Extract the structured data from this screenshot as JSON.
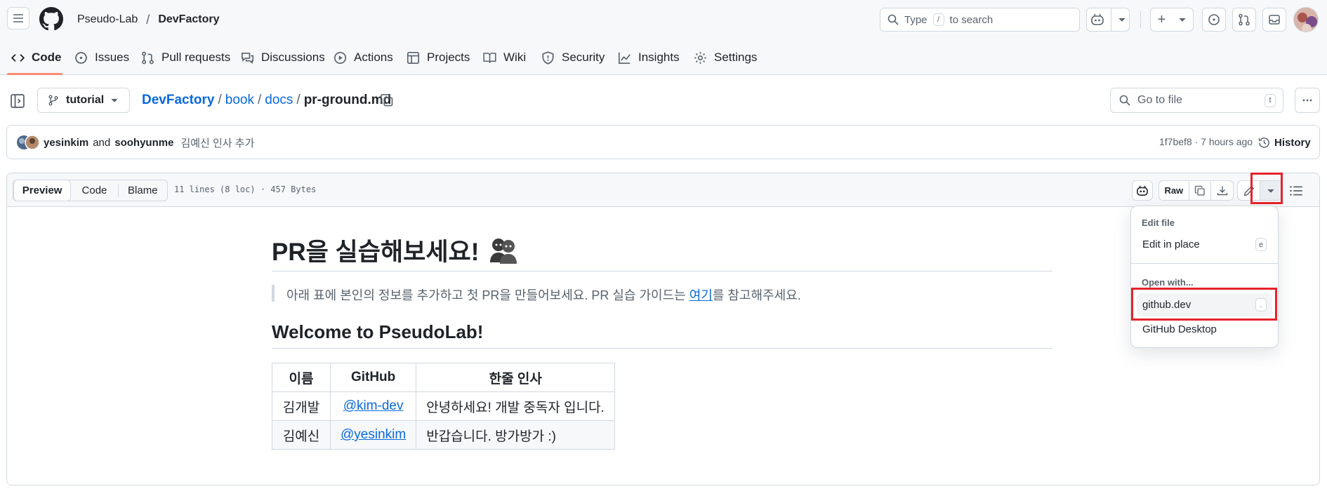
{
  "header": {
    "owner": "Pseudo-Lab",
    "separator": "/",
    "repo": "DevFactory",
    "search_placeholder_pre": "Type",
    "search_key": "/",
    "search_placeholder_post": "to search",
    "plus_label": "+"
  },
  "nav": {
    "code": "Code",
    "issues": "Issues",
    "pull_requests": "Pull requests",
    "discussions": "Discussions",
    "actions": "Actions",
    "projects": "Projects",
    "wiki": "Wiki",
    "security": "Security",
    "insights": "Insights",
    "settings": "Settings"
  },
  "file_header": {
    "branch": "tutorial",
    "path_repo": "DevFactory",
    "path_1": "book",
    "path_2": "docs",
    "file_name": "pr-ground.md",
    "slash": "/",
    "go_to_file": "Go to file",
    "go_to_file_key": "t"
  },
  "commit": {
    "author_1": "yesinkim",
    "and": "and",
    "author_2": "soohyunme",
    "message": "김예신 인사 추가",
    "hash_time": "1f7bef8 · 7 hours ago",
    "history": "History"
  },
  "toolbar": {
    "preview": "Preview",
    "code": "Code",
    "blame": "Blame",
    "file_info": "11 lines (8 loc) · 457 Bytes",
    "raw": "Raw"
  },
  "content": {
    "title": "PR을 실습해보세요!",
    "quote_pre": "아래 표에 본인의 정보를 추가하고 첫 PR을 만들어보세요. PR 실습 가이드는 ",
    "quote_link": "여기",
    "quote_post": "를 참고해주세요.",
    "h2": "Welcome to PseudoLab!",
    "table": {
      "headers": [
        "이름",
        "GitHub",
        "한줄 인사"
      ],
      "rows": [
        [
          "김개발",
          "@kim-dev",
          "안녕하세요! 개발 중독자 입니다."
        ],
        [
          "김예신",
          "@yesinkim",
          "반갑습니다. 방가방가 :)"
        ]
      ]
    }
  },
  "dropdown": {
    "edit_file_heading": "Edit file",
    "edit_in_place": "Edit in place",
    "edit_in_place_key": "e",
    "open_with_heading": "Open with...",
    "github_dev": "github.dev",
    "github_dev_key": ".",
    "github_desktop": "GitHub Desktop"
  },
  "colors": {
    "accent_link": "#0969da",
    "nav_underline": "#fd8c73",
    "highlight_box": "#e5232b",
    "border": "#d1d9e0"
  }
}
